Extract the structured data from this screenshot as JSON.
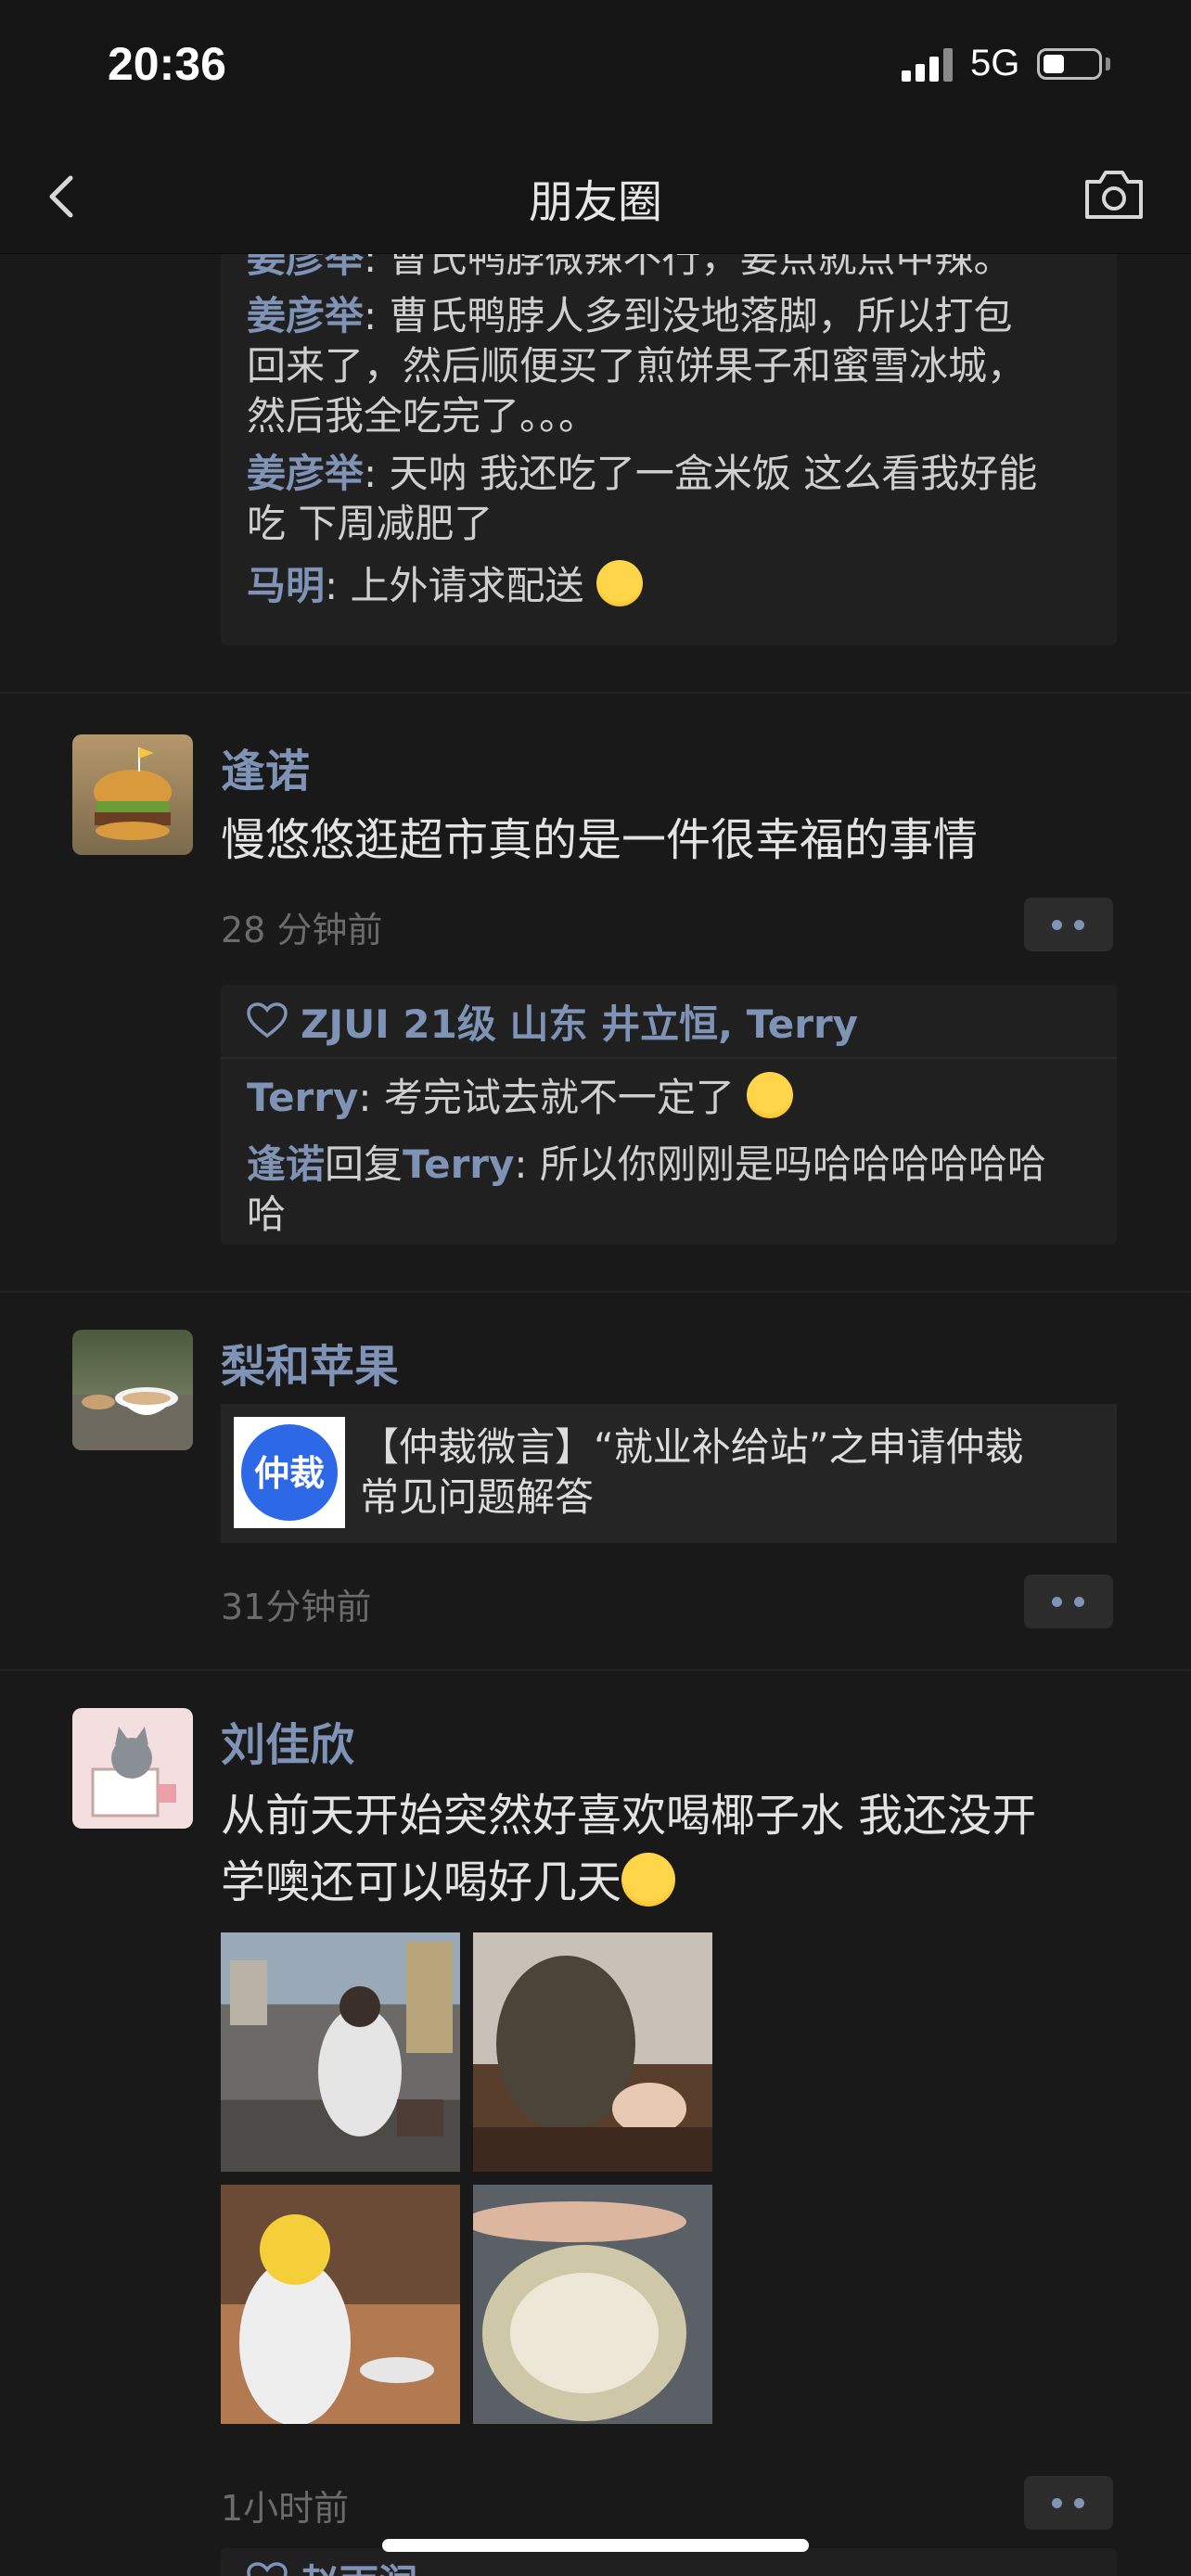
{
  "status_bar": {
    "time": "20:36",
    "network": "5G",
    "battery_level": 0.3
  },
  "nav": {
    "title": "朋友圈",
    "back_icon": "chevron-left-icon",
    "camera_icon": "camera-icon"
  },
  "colors": {
    "background": "#191919",
    "name_link": "#7f93b6",
    "comment_box": "#202020",
    "time_text": "#6b6b6b"
  },
  "top_comments": [
    {
      "name": "姜彦举",
      "text": ": 曹氏鸭脖微辣不行，要点就点中辣。"
    },
    {
      "name": "姜彦举",
      "text": ": 曹氏鸭脖人多到没地落脚，所以打包",
      "cont": [
        "回来了，然后顺便买了煎饼果子和蜜雪冰城，",
        "然后我全吃完了。。。"
      ]
    },
    {
      "name": "姜彦举",
      "text": ": 天呐 我还吃了一盒米饭 这么看我好能",
      "cont": [
        "吃 下周减肥了"
      ]
    },
    {
      "name": "马明",
      "text": ": 上外请求配送",
      "emoji": "crying-emoji"
    }
  ],
  "posts": [
    {
      "name": "逢诺",
      "text": "慢悠悠逛超市真的是一件很幸福的事情",
      "time": "28 分钟前",
      "likes": "ZJUI 21级 山东 井立恒, Terry",
      "comments": [
        {
          "name": "Terry",
          "text": ": 考完试去就不一定了",
          "emoji": "grimace-emoji"
        },
        {
          "name": "逢诺",
          "reply_word": "回复",
          "reply_to": "Terry",
          "text": ": 所以你刚刚是吗哈哈哈哈哈哈",
          "cont": [
            "哈"
          ]
        }
      ]
    },
    {
      "name": "梨和苹果",
      "link_title_1": "【仲裁微言】“就业补给站”之申请仲裁",
      "link_title_2": "常见问题解答",
      "link_thumb_text": "仲裁",
      "time": "31分钟前"
    },
    {
      "name": "刘佳欣",
      "text_1": "从前天开始突然好喜欢喝椰子水 我还没开",
      "text_2": "学噢还可以喝好几天",
      "emoji": "tongue-emoji",
      "time": "1小时前",
      "photos": [
        "street-photo",
        "coconut-photo",
        "table-photo",
        "coconut-open-photo"
      ]
    }
  ],
  "bottom_peek": {
    "name": "赵雨润"
  }
}
